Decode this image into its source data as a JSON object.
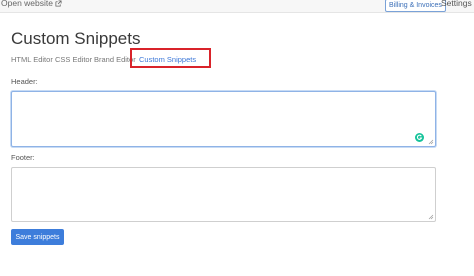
{
  "topbar": {
    "open_website_label": "Open website",
    "billing_label": "Billing & Invoices",
    "settings_label": "Settings"
  },
  "page": {
    "title": "Custom Snippets"
  },
  "tabs": [
    {
      "label": "HTML Editor",
      "active": false
    },
    {
      "label": "CSS Editor",
      "active": false
    },
    {
      "label": "Brand Editor",
      "active": false
    },
    {
      "label": "Custom Snippets",
      "active": true
    }
  ],
  "form": {
    "header_label": "Header:",
    "header_value": "",
    "footer_label": "Footer:",
    "footer_value": "",
    "save_label": "Save snippets"
  },
  "colors": {
    "accent": "#3d7ddb",
    "highlight": "#d9232a",
    "grammarly": "#15c39a"
  },
  "icons": [
    "external-link-icon",
    "resize-grip-icon",
    "grammarly-icon"
  ]
}
